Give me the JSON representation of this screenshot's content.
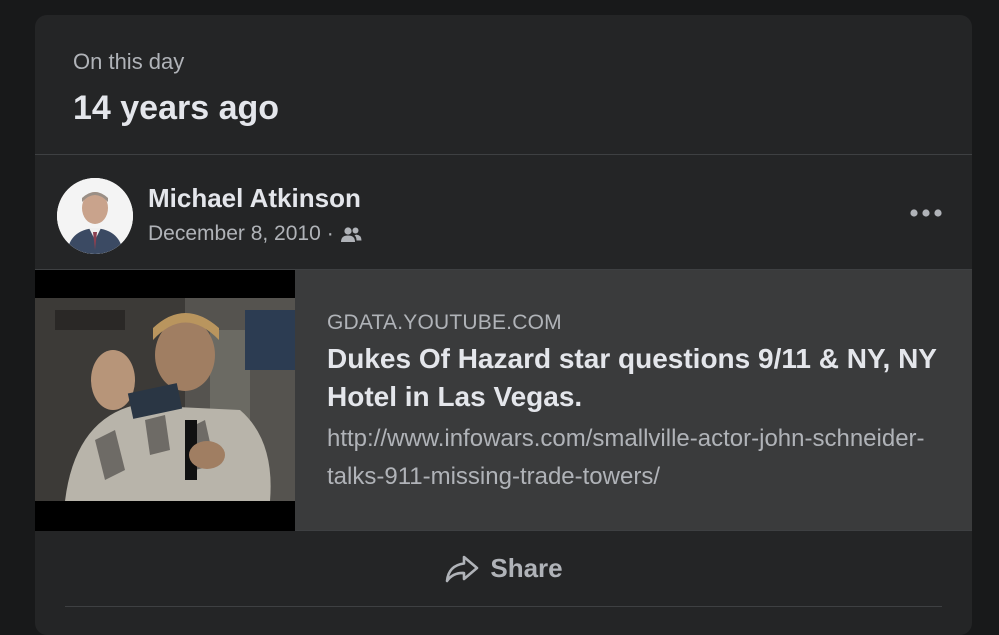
{
  "memory": {
    "label": "On this day",
    "title": "14 years ago"
  },
  "post": {
    "author": "Michael Atkinson",
    "date": "December 8, 2010",
    "separator": "·",
    "audience_icon": "friends-icon",
    "more_icon": "more-options-icon"
  },
  "link_preview": {
    "domain": "GDATA.YOUTUBE.COM",
    "title": "Dukes Of Hazard star questions 9/11 & NY, NY Hotel in Las Vegas.",
    "description": "http://www.infowars.com/smallville-actor-john-schneider-talks-911-missing-trade-towers/"
  },
  "actions": {
    "share_label": "Share",
    "share_icon": "share-arrow-icon"
  },
  "colors": {
    "page_background": "#18191a",
    "card_background": "#242526",
    "preview_background": "#3a3b3c",
    "primary_text": "#e4e6eb",
    "secondary_text": "#b0b3b8"
  }
}
